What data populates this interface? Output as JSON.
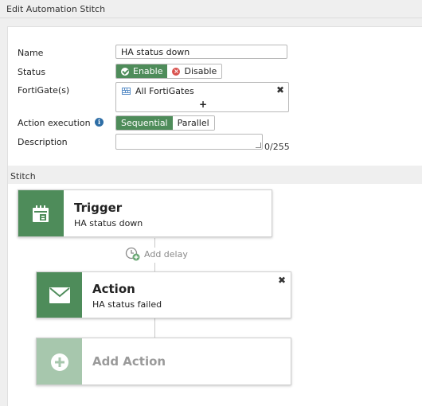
{
  "window": {
    "title": "Edit Automation Stitch"
  },
  "form": {
    "name_label": "Name",
    "name_value": "HA status down",
    "status_label": "Status",
    "status_options": [
      "Enable",
      "Disable"
    ],
    "status_selected": "Enable",
    "fortigates_label": "FortiGate(s)",
    "fortigates_value": "All FortiGates",
    "add_symbol": "+",
    "remove_symbol": "✖",
    "action_execution_label": "Action execution",
    "action_execution_options": [
      "Sequential",
      "Parallel"
    ],
    "action_execution_selected": "Sequential",
    "description_label": "Description",
    "description_value": "",
    "description_counter": "0/255"
  },
  "stitch": {
    "section_label": "Stitch",
    "trigger": {
      "title": "Trigger",
      "subtitle": "HA status down"
    },
    "add_delay_label": "Add delay",
    "action": {
      "title": "Action",
      "subtitle": "HA status failed"
    },
    "add_action_label": "Add Action"
  },
  "colors": {
    "accent": "#4e8c5a",
    "accent_light": "#a7c7ad",
    "disable_red": "#d9534f",
    "info_blue": "#2e6ea6"
  },
  "icons": {
    "enable": "check-circle-icon",
    "disable": "x-circle-icon",
    "fortigates": "fortigate-device-icon",
    "info": "info-icon",
    "trigger": "calendar-icon",
    "delay": "clock-add-icon",
    "action": "envelope-icon",
    "add_action": "plus-circle-icon"
  }
}
